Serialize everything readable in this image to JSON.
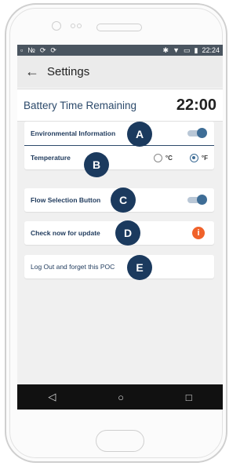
{
  "status_bar": {
    "time": "22:24"
  },
  "toolbar": {
    "back_icon": "arrow-left-icon",
    "title": "Settings"
  },
  "battery": {
    "label": "Battery Time Remaining",
    "value": "22:00"
  },
  "settings": {
    "environmental": {
      "label": "Environmental Information",
      "toggle_on": true,
      "marker": "A"
    },
    "temperature": {
      "label": "Temperature",
      "marker": "B",
      "option_c": "°C",
      "option_f": "°F",
      "selected": "°F"
    },
    "flow": {
      "label": "Flow Selection Button",
      "toggle_on": true,
      "marker": "C"
    },
    "update": {
      "label": "Check now for update",
      "marker": "D",
      "icon": "info-alert-icon",
      "icon_glyph": "i"
    },
    "logout": {
      "label": "Log Out and forget this POC",
      "marker": "E"
    }
  },
  "colors": {
    "accent": "#3e6d96",
    "marker_bg": "#1b3a5e",
    "alert": "#f0622a",
    "status_bar": "#4a5560"
  }
}
